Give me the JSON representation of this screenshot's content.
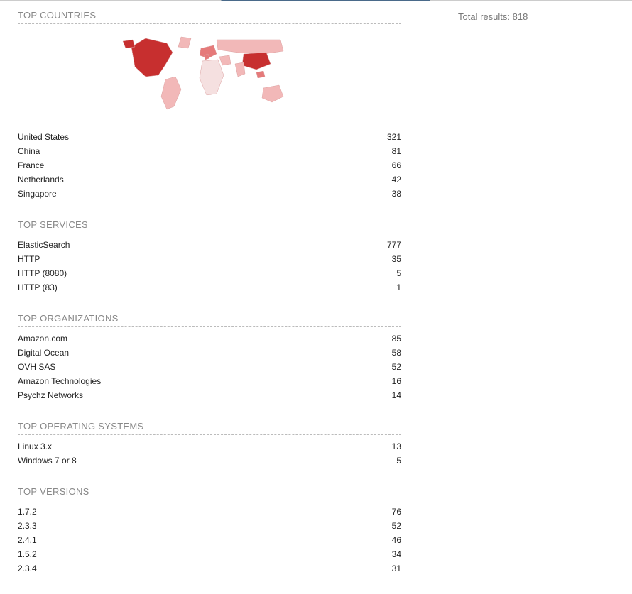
{
  "total_results_label": "Total results:",
  "total_results_value": "818",
  "sections": {
    "countries": {
      "title": "TOP COUNTRIES",
      "items": [
        {
          "label": "United States",
          "value": "321"
        },
        {
          "label": "China",
          "value": "81"
        },
        {
          "label": "France",
          "value": "66"
        },
        {
          "label": "Netherlands",
          "value": "42"
        },
        {
          "label": "Singapore",
          "value": "38"
        }
      ]
    },
    "services": {
      "title": "TOP SERVICES",
      "items": [
        {
          "label": "ElasticSearch",
          "value": "777"
        },
        {
          "label": "HTTP",
          "value": "35"
        },
        {
          "label": "HTTP (8080)",
          "value": "5"
        },
        {
          "label": "HTTP (83)",
          "value": "1"
        }
      ]
    },
    "organizations": {
      "title": "TOP ORGANIZATIONS",
      "items": [
        {
          "label": "Amazon.com",
          "value": "85"
        },
        {
          "label": "Digital Ocean",
          "value": "58"
        },
        {
          "label": "OVH SAS",
          "value": "52"
        },
        {
          "label": "Amazon Technologies",
          "value": "16"
        },
        {
          "label": "Psychz Networks",
          "value": "14"
        }
      ]
    },
    "os": {
      "title": "TOP OPERATING SYSTEMS",
      "items": [
        {
          "label": "Linux 3.x",
          "value": "13"
        },
        {
          "label": "Windows 7 or 8",
          "value": "5"
        }
      ]
    },
    "versions": {
      "title": "TOP VERSIONS",
      "items": [
        {
          "label": "1.7.2",
          "value": "76"
        },
        {
          "label": "2.3.3",
          "value": "52"
        },
        {
          "label": "2.4.1",
          "value": "46"
        },
        {
          "label": "1.5.2",
          "value": "34"
        },
        {
          "label": "2.3.4",
          "value": "31"
        }
      ]
    }
  },
  "map": {
    "colors": {
      "high": "#c72f2f",
      "mid": "#e57a7a",
      "low": "#f2b8b8",
      "empty": "#f5e0e0",
      "stroke": "#dca0a0"
    }
  }
}
